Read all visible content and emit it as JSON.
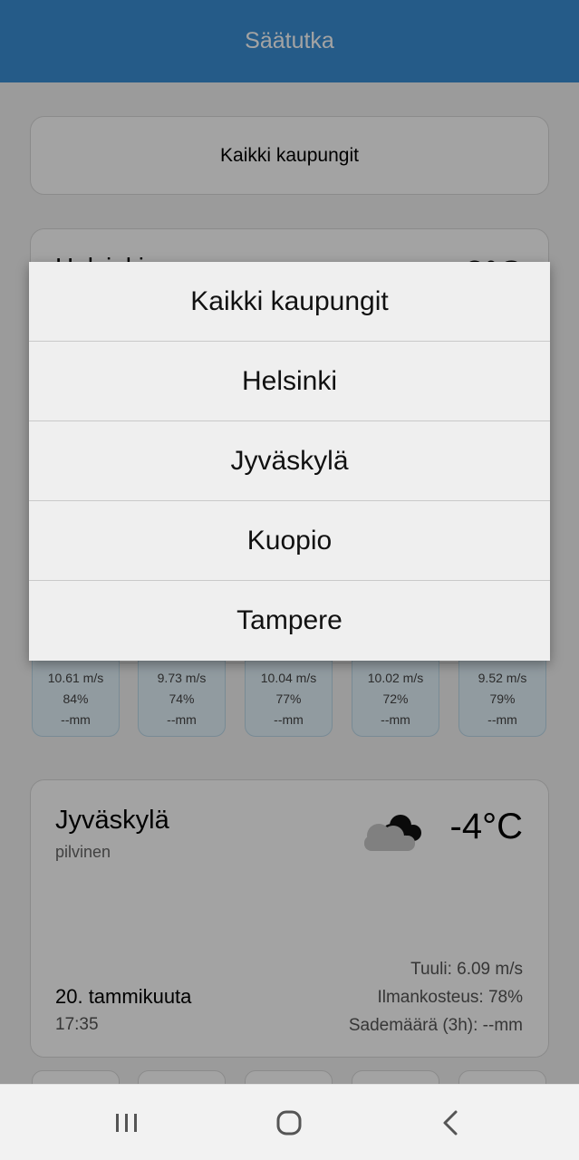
{
  "app": {
    "title": "Säätutka"
  },
  "selector": {
    "label": "Kaikki kaupungit"
  },
  "helsinki": {
    "name": "Helsinki",
    "temp": "3°C"
  },
  "forecast": [
    {
      "wind": "10.61 m/s",
      "humidity": "84%",
      "rain": "--mm"
    },
    {
      "wind": "9.73 m/s",
      "humidity": "74%",
      "rain": "--mm"
    },
    {
      "wind": "10.04 m/s",
      "humidity": "77%",
      "rain": "--mm"
    },
    {
      "wind": "10.02 m/s",
      "humidity": "72%",
      "rain": "--mm"
    },
    {
      "wind": "9.52 m/s",
      "humidity": "79%",
      "rain": "--mm"
    }
  ],
  "jyvaskyla": {
    "name": "Jyväskylä",
    "description": "pilvinen",
    "temp": "-4°C",
    "icon": "cloudy-icon",
    "date": "20. tammikuuta",
    "time": "17:35",
    "wind": "Tuuli: 6.09 m/s",
    "humidity": "Ilmankosteus: 78%",
    "rain": "Sademäärä (3h): --mm"
  },
  "dialog": {
    "options": [
      "Kaikki kaupungit",
      "Helsinki",
      "Jyväskylä",
      "Kuopio",
      "Tampere"
    ]
  },
  "navbar": {
    "icons": [
      "recent-apps-icon",
      "home-icon",
      "back-icon"
    ]
  },
  "colors": {
    "appbar": "#3b8fd5",
    "forecast_bg": "#e3f2fb",
    "dialog_bg": "#efefef"
  }
}
